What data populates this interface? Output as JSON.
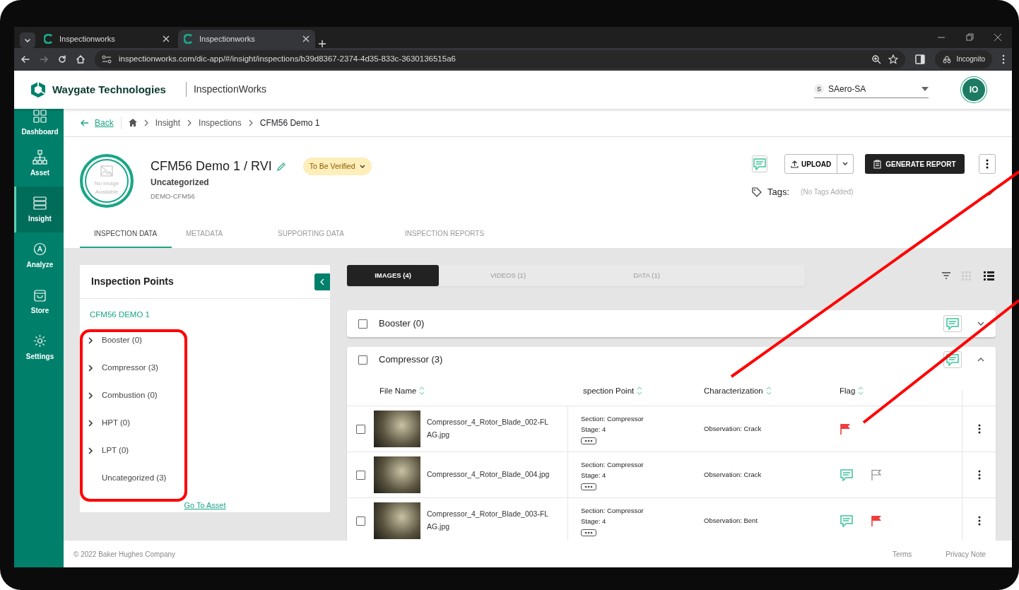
{
  "browser": {
    "tabs": [
      {
        "title": "Inspectionworks",
        "selected": false
      },
      {
        "title": "Inspectionworks",
        "selected": true
      }
    ],
    "url": "inspectionworks.com/dic-app/#/insight/inspections/b39d8367-2374-4d35-833c-3630136515a6",
    "profile": "Incognito"
  },
  "header": {
    "brand": "Waygate Technologies",
    "app_name": "InspectionWorks",
    "tenant": {
      "initial": "S",
      "name": "SAero-SA"
    },
    "avatar": "IO"
  },
  "sidebar": {
    "items": [
      {
        "label": "Dashboard",
        "kind": "dashboard",
        "selected": false
      },
      {
        "label": "Asset",
        "kind": "asset",
        "selected": false
      },
      {
        "label": "Insight",
        "kind": "insight",
        "selected": true
      },
      {
        "label": "Analyze",
        "kind": "analyze",
        "selected": false
      },
      {
        "label": "Store",
        "kind": "store",
        "selected": false
      },
      {
        "label": "Settings",
        "kind": "settings",
        "selected": false
      }
    ]
  },
  "breadcrumb": {
    "back": "Back",
    "items": [
      "Insight",
      "Inspections",
      "CFM56 Demo 1"
    ]
  },
  "inspection": {
    "image_text": "No Image Available",
    "title": "CFM56 Demo 1 / RVI",
    "status": "To Be Verified",
    "category": "Uncategorized",
    "code": "DEMO-CFM56",
    "upload": "UPLOAD",
    "generate": "GENERATE REPORT",
    "tags_label": "Tags:",
    "tags_empty": "(No Tags Added)"
  },
  "tabs": [
    {
      "label": "INSPECTION DATA",
      "selected": true
    },
    {
      "label": "METADATA",
      "selected": false
    },
    {
      "label": "SUPPORTING DATA",
      "selected": false
    },
    {
      "label": "INSPECTION REPORTS",
      "selected": false
    }
  ],
  "points": {
    "title": "Inspection Points",
    "root": "CFM56 DEMO 1",
    "items": [
      {
        "label": "Booster (0)",
        "expandable": true
      },
      {
        "label": "Compressor (3)",
        "expandable": true
      },
      {
        "label": "Combustion (0)",
        "expandable": true
      },
      {
        "label": "HPT (0)",
        "expandable": true
      },
      {
        "label": "LPT (0)",
        "expandable": true
      },
      {
        "label": "Uncategorized (3)",
        "expandable": false
      }
    ],
    "link": "Go To Asset"
  },
  "media_tabs": [
    {
      "label": "IMAGES (4)",
      "selected": true
    },
    {
      "label": "VIDEOS (1)",
      "selected": false
    },
    {
      "label": "DATA (1)",
      "selected": false
    }
  ],
  "view_modes": [
    {
      "kind": "grid",
      "selected": false
    },
    {
      "kind": "list",
      "selected": true
    }
  ],
  "groups": [
    {
      "title": "Booster (0)",
      "expanded": false,
      "checked": false
    },
    {
      "title": "Compressor (3)",
      "expanded": true,
      "checked": false,
      "columns": [
        "File Name",
        "spection Point",
        "Characterization",
        "Flag"
      ],
      "rows": [
        {
          "file": "Compressor_4_Rotor_Blade_002-FLAG.jpg",
          "section": "Section: Compressor",
          "stage": "Stage: 4",
          "characterization": "Observation: Crack",
          "comment": false,
          "flagged": true,
          "checked": false
        },
        {
          "file": "Compressor_4_Rotor_Blade_004.jpg",
          "section": "Section: Compressor",
          "stage": "Stage: 4",
          "characterization": "Observation: Crack",
          "comment": true,
          "flagged": false,
          "checked": false
        },
        {
          "file": "Compressor_4_Rotor_Blade_003-FLAG.jpg",
          "section": "Section: Compressor",
          "stage": "Stage: 4",
          "characterization": "Observation: Bent",
          "comment": true,
          "flagged": true,
          "checked": false
        }
      ]
    }
  ],
  "footer": {
    "copyright": "© 2022 Baker Hughes Company",
    "links": [
      "Terms",
      "Privacy Note"
    ]
  }
}
